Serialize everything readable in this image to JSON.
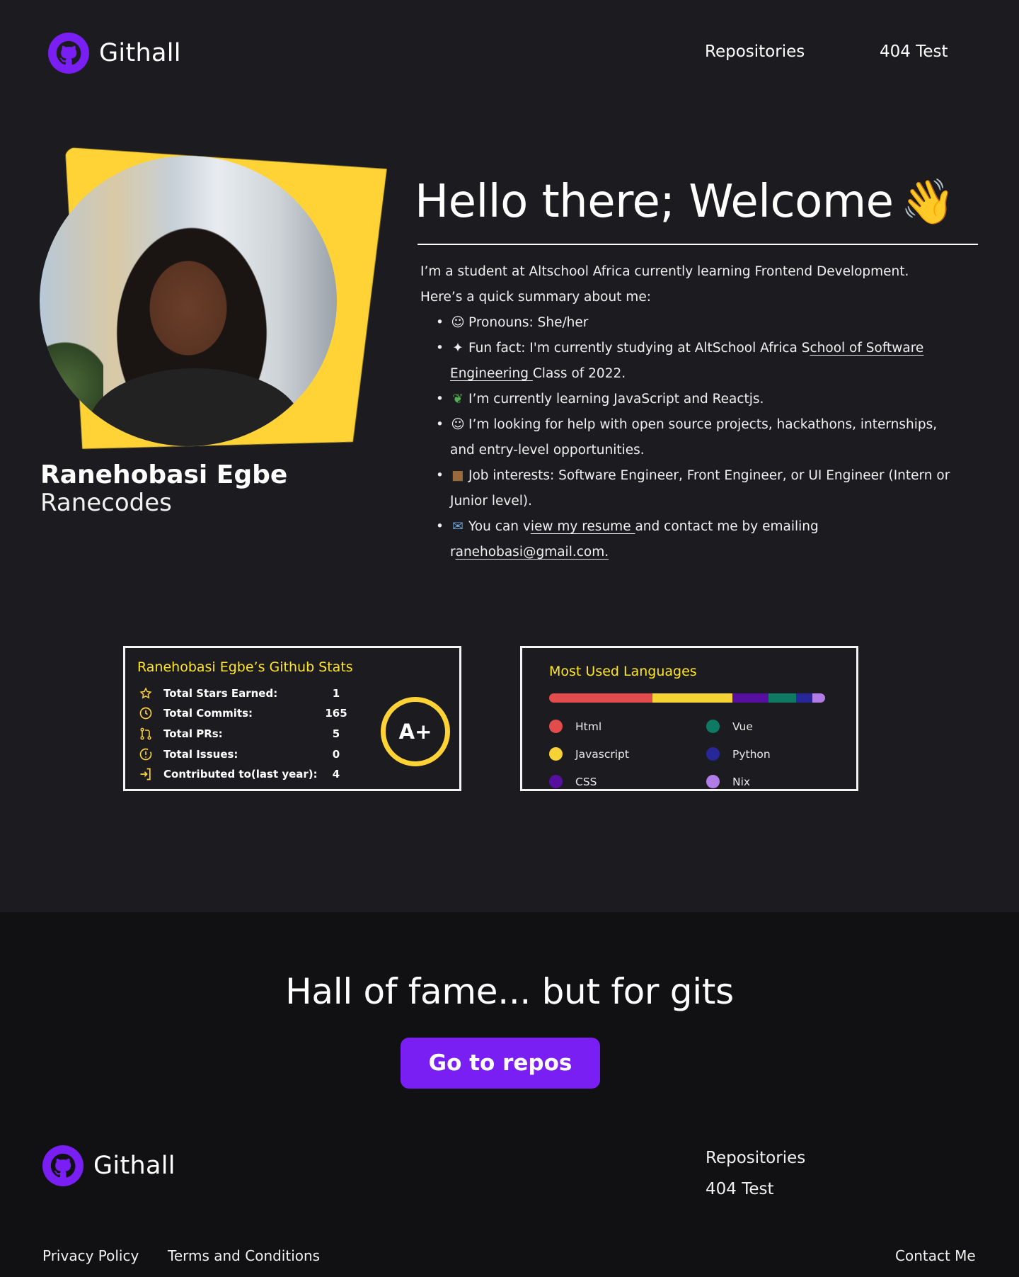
{
  "header": {
    "brand": "Githall",
    "nav": [
      "Repositories",
      "404 Test"
    ]
  },
  "profile": {
    "name": "Ranehobasi Egbe",
    "handle": "Ranecodes"
  },
  "intro": {
    "heading": "Hello there; Welcome",
    "line1": "I’m a student at Altschool Africa currently learning Frontend Development.",
    "line2": "Here’s a quick summary about me:",
    "pronouns": "Pronouns: She/her",
    "fun_fact_a": "Fun fact: I'm currently studying at AltSchool Africa S",
    "fun_fact_link": "chool of Software Engineering ",
    "fun_fact_b": "Class of 2022.",
    "learning": "I’m currently learning JavaScript and Reactjs.",
    "help": "I’m looking for help with open source projects, hackathons, internships, and entry-level opportunities.",
    "jobs": "Job interests: Software Engineer, Front Engineer, or UI Engineer (Intern or Junior level).",
    "resume_a": "You can v",
    "resume_link": "iew my resume ",
    "resume_b": "and contact me by emailing",
    "email_a": "r",
    "email_link": "anehobasi@gmail.com."
  },
  "stats": {
    "title": "Ranehobasi Egbe’s Github Stats",
    "rows": [
      {
        "label": "Total Stars Earned:",
        "value": "1",
        "icon": "star-icon"
      },
      {
        "label": "Total Commits:",
        "value": "165",
        "icon": "clock-icon"
      },
      {
        "label": "Total PRs:",
        "value": "5",
        "icon": "pull-request-icon"
      },
      {
        "label": "Total Issues:",
        "value": "0",
        "icon": "issue-icon"
      },
      {
        "label": "Contributed to(last year):",
        "value": "4",
        "icon": "contribute-icon"
      }
    ],
    "grade": "A+"
  },
  "languages": {
    "title": "Most Used Languages",
    "items": [
      {
        "name": "Html",
        "color": "#e34c4c",
        "share": 0.375
      },
      {
        "name": "Javascript",
        "color": "#f7d234",
        "share": 0.29
      },
      {
        "name": "CSS",
        "color": "#560f9f",
        "share": 0.13
      },
      {
        "name": "Vue",
        "color": "#0e7a64",
        "share": 0.1
      },
      {
        "name": "Python",
        "color": "#27279a",
        "share": 0.06
      },
      {
        "name": "Nix",
        "color": "#b27ce6",
        "share": 0.045
      }
    ]
  },
  "bottom": {
    "fame": "Hall of fame... but for gits",
    "cta": "Go to repos",
    "brand": "Githall",
    "links": [
      "Repositories",
      "404 Test"
    ],
    "legal": [
      "Privacy Policy",
      "Terms and Conditions",
      "Contact Me"
    ]
  },
  "colors": {
    "accent": "#7a1ff3",
    "highlight": "#ffd336",
    "background": "#1c1c20",
    "footer_background": "#111113"
  }
}
